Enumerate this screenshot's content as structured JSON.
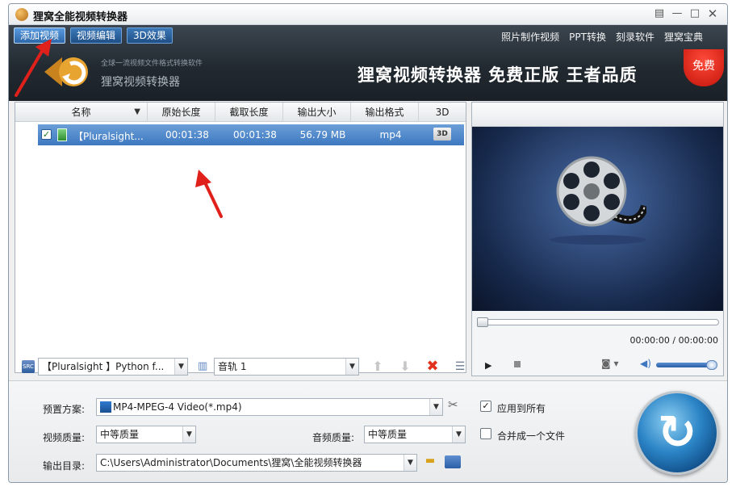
{
  "window": {
    "title": "狸窝全能视频转换器",
    "controls": {
      "menu": "▤",
      "minimize": "—",
      "maximize": "□",
      "close": "✕"
    }
  },
  "toolbar": {
    "tabs": [
      {
        "label": "添加视频",
        "active": true
      },
      {
        "label": "视频编辑",
        "active": false
      },
      {
        "label": "3D效果",
        "active": false
      }
    ],
    "links": [
      "照片制作视频",
      "PPT转换",
      "刻录软件",
      "狸窝宝典"
    ]
  },
  "banner": {
    "subtitle": "全球一流视频文件格式转换软件",
    "name": "狸窝视频转换器",
    "slogan": "狸窝视频转换器 免费正版 王者品质",
    "badge": "免费"
  },
  "file_list": {
    "columns": [
      "名称",
      "原始长度",
      "截取长度",
      "输出大小",
      "输出格式",
      "3D"
    ],
    "rows": [
      {
        "checked": true,
        "name": "【Pluralsight...",
        "original_length": "00:01:38",
        "cut_length": "00:01:38",
        "output_size": "56.79 MB",
        "output_format": "mp4",
        "three_d": "3D"
      }
    ]
  },
  "file_bar": {
    "subtitle_track": "【Pluralsight 】Python f...",
    "audio_track": "音轨 1"
  },
  "preview": {
    "time": "00:00:00 / 00:00:00",
    "volume": 1.0
  },
  "settings": {
    "preset_label": "预置方案:",
    "preset_value": "MP4-MPEG-4 Video(*.mp4)",
    "apply_all_label": "应用到所有",
    "apply_all_checked": true,
    "video_quality_label": "视频质量:",
    "video_quality_value": "中等质量",
    "audio_quality_label": "音频质量:",
    "audio_quality_value": "中等质量",
    "merge_label": "合并成一个文件",
    "merge_checked": false,
    "output_dir_label": "输出目录:",
    "output_dir_value": "C:\\Users\\Administrator\\Documents\\狸窝\\全能视频转换器"
  },
  "colors": {
    "accent": "#3d78c0",
    "banner_bg": "#222a31",
    "badge_red": "#c3130a",
    "annotation_red": "#e0201a"
  },
  "icons": [
    "app-logo-icon",
    "menu-icon",
    "minimize-icon",
    "maximize-icon",
    "close-icon",
    "checkbox-icon",
    "video-file-icon",
    "3d-icon",
    "subtitle-icon",
    "audio-track-icon",
    "move-up-icon",
    "move-down-icon",
    "delete-icon",
    "clear-list-icon",
    "play-icon",
    "stop-icon",
    "camera-icon",
    "volume-icon",
    "preset-icon",
    "settings-tools-icon",
    "folder-icon",
    "open-directory-icon",
    "convert-icon"
  ]
}
